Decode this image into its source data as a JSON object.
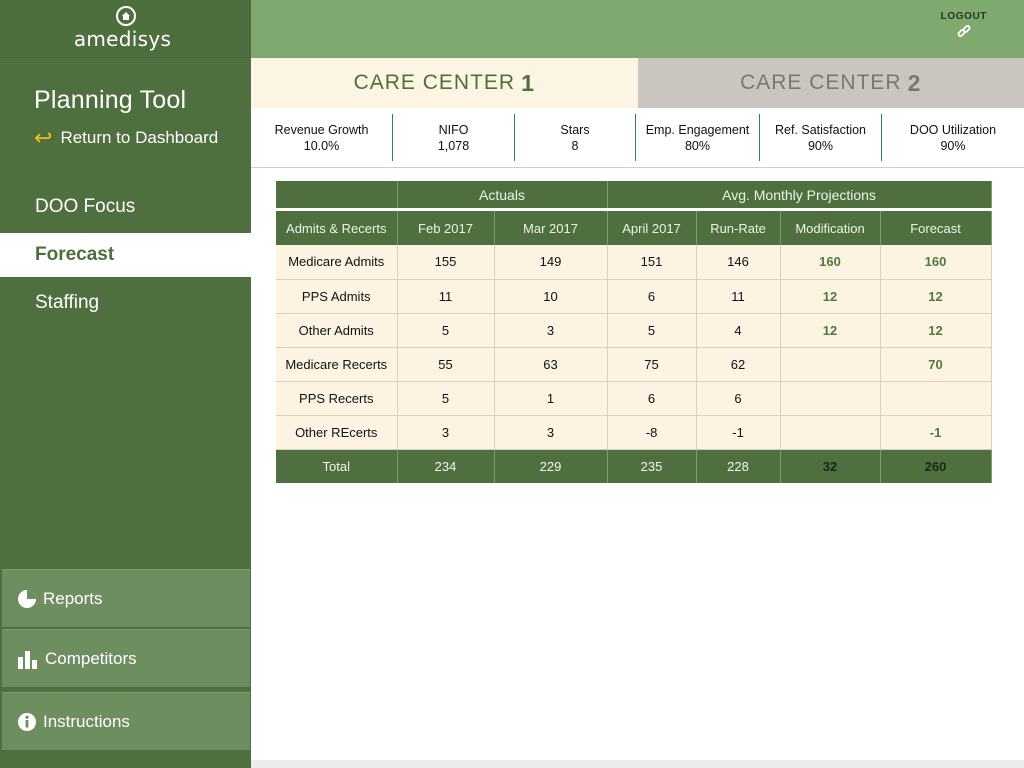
{
  "brand": {
    "name": "amedisys"
  },
  "sidebar": {
    "title": "Planning Tool",
    "return_label": "Return to Dashboard",
    "nav": [
      {
        "label": "DOO Focus",
        "active": false
      },
      {
        "label": "Forecast",
        "active": true
      },
      {
        "label": "Staffing",
        "active": false
      }
    ],
    "bottom": [
      {
        "label": "Reports",
        "icon": "pie-chart-icon"
      },
      {
        "label": "Competitors",
        "icon": "bar-chart-icon"
      },
      {
        "label": "Instructions",
        "icon": "info-icon"
      }
    ]
  },
  "header": {
    "logout_label": "LOGOUT",
    "logout_icon": "link-icon"
  },
  "tabs": [
    {
      "label": "CARE CENTER",
      "num": "1",
      "active": true
    },
    {
      "label": "CARE CENTER",
      "num": "2",
      "active": false
    }
  ],
  "kpis": [
    {
      "label": "Revenue Growth",
      "value": "10.0%"
    },
    {
      "label": "NIFO",
      "value": "1,078"
    },
    {
      "label": "Stars",
      "value": "8"
    },
    {
      "label": "Emp. Engagement",
      "value": "80%"
    },
    {
      "label": "Ref. Satisfaction",
      "value": "90%"
    },
    {
      "label": "DOO Utilization",
      "value": "90%"
    }
  ],
  "table": {
    "groups": {
      "actuals": "Actuals",
      "projections": "Avg. Monthly Projections"
    },
    "columns": [
      "Admits & Recerts",
      "Feb 2017",
      "Mar 2017",
      "April 2017",
      "Run-Rate",
      "Modification",
      "Forecast"
    ],
    "rows": [
      {
        "label": "Medicare Admits",
        "feb": "155",
        "mar": "149",
        "apr": "151",
        "run": "146",
        "mod": "160",
        "fc": "160"
      },
      {
        "label": "PPS Admits",
        "feb": "11",
        "mar": "10",
        "apr": "6",
        "run": "11",
        "mod": "12",
        "fc": "12"
      },
      {
        "label": "Other Admits",
        "feb": "5",
        "mar": "3",
        "apr": "5",
        "run": "4",
        "mod": "12",
        "fc": "12"
      },
      {
        "label": "Medicare Recerts",
        "feb": "55",
        "mar": "63",
        "apr": "75",
        "run": "62",
        "mod": "",
        "fc": "70"
      },
      {
        "label": "PPS Recerts",
        "feb": "5",
        "mar": "1",
        "apr": "6",
        "run": "6",
        "mod": "",
        "fc": ""
      },
      {
        "label": "Other REcerts",
        "feb": "3",
        "mar": "3",
        "apr": "-8",
        "run": "-1",
        "mod": "",
        "fc": "-1"
      }
    ],
    "total": {
      "label": "Total",
      "feb": "234",
      "mar": "229",
      "apr": "235",
      "run": "228",
      "mod": "32",
      "fc": "260"
    }
  },
  "colors": {
    "primary": "#4f6f3e",
    "header": "#7fa96e",
    "accent": "#e8c21a",
    "cell_bg": "#fdf3e2"
  }
}
